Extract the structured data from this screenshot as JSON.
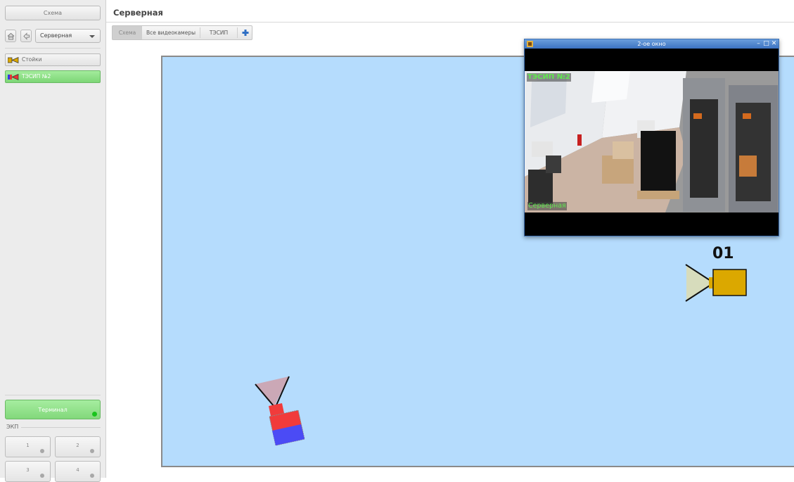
{
  "sidebar": {
    "schema_button": "Схема",
    "location_select": {
      "selected": "Серверная"
    },
    "cameras": [
      {
        "label": "Стойки",
        "state": "normal"
      },
      {
        "label": "ТЭСИП №2",
        "state": "active"
      }
    ],
    "terminal_button": "Терминал",
    "ekp": {
      "label": "ЭКП",
      "buttons": [
        "1",
        "2",
        "3",
        "4"
      ]
    }
  },
  "main": {
    "title": "Серверная",
    "tabs": [
      {
        "label": "Схема",
        "active": true
      },
      {
        "label": "Все видеокамеры",
        "active": false
      },
      {
        "label": "ТЭСИП",
        "active": false
      }
    ],
    "plan": {
      "camera_label": "01"
    }
  },
  "video_window": {
    "title": "2-ое окно",
    "osd_camera_name": "ТЭСИП №2",
    "osd_location": "Серверная"
  },
  "colors": {
    "plan_background": "#b5dcfd",
    "active_green": "#82d87b",
    "title_bar": "#3c72c1",
    "osd_text": "#60e84f",
    "camera_gold": "#dba800",
    "camera_red": "#f13b3b",
    "camera_blue": "#4b4bf5"
  }
}
